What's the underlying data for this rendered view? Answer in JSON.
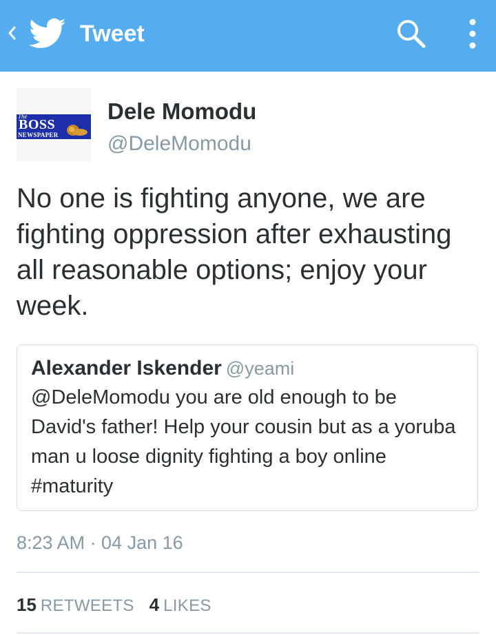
{
  "topbar": {
    "title": "Tweet",
    "back_icon": "chevron-left-icon",
    "logo_icon": "twitter-bird-icon",
    "search_icon": "search-icon",
    "menu_icon": "overflow-menu-icon",
    "color": "#55acee"
  },
  "author": {
    "avatar_logo": {
      "top_word": "The",
      "main_word": "BOSS",
      "bottom_word": "NEWSPAPER"
    },
    "name": "Dele Momodu",
    "handle": "@DeleMomodu"
  },
  "tweet": {
    "text": "No one is fighting anyone, we are fighting oppression after exhausting all reasonable options; enjoy your week."
  },
  "quoted_tweet": {
    "name": "Alexander Iskender",
    "handle": "@yeami",
    "text": "@DeleMomodu  you are old enough to be David's father! Help your cousin but as a yoruba man u loose dignity fighting a boy online #maturity"
  },
  "timestamp": "8:23 AM · 04 Jan 16",
  "stats": {
    "retweets_count": "15",
    "retweets_label": "RETWEETS",
    "likes_count": "4",
    "likes_label": "LIKES"
  },
  "colors": {
    "accent": "#55acee",
    "text": "#292f33",
    "muted": "#8899a6",
    "border": "#e1e8ed"
  }
}
